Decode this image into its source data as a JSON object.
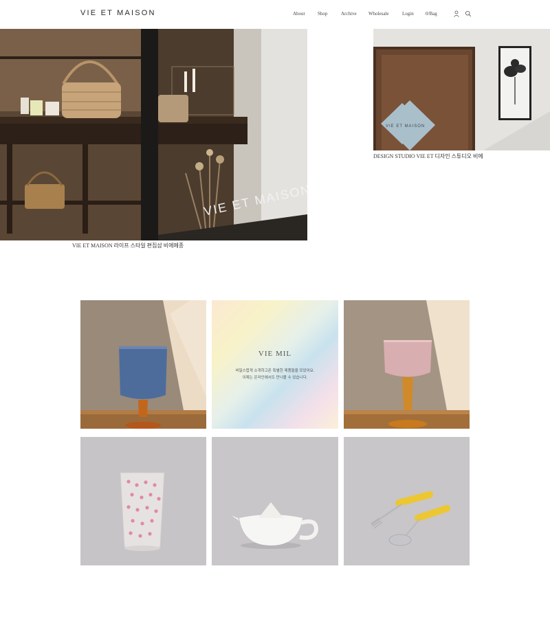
{
  "header": {
    "logo": "VIE ET MAISON",
    "nav": [
      "About",
      "Shop",
      "Archive",
      "Wholesale",
      "Login",
      "0/Bag"
    ],
    "icons": [
      "user-icon",
      "search-icon"
    ]
  },
  "hero": {
    "left_caption": "VIE ET MAISON 라이프 스타일 편집샵 비에메종",
    "left_sign": "VIE ET MAISON",
    "right_caption": "DESIGN STUDIO VIE ET 디자인 스튜디오 비에",
    "right_sign": "VIE ET MAISON"
  },
  "promo": {
    "title": "VIE MIL",
    "line1": "비밀스럽게 소개하고픈 특별한 제품들을 모았어요.",
    "line2": "이제는 온라인에서도 만나볼 수 있습니다."
  },
  "colors": {
    "blue_glass": "#4d6c9c",
    "pink_glass": "#d8aeb0",
    "amber_stem": "#c2661c",
    "yellow_handle": "#ecc732"
  }
}
